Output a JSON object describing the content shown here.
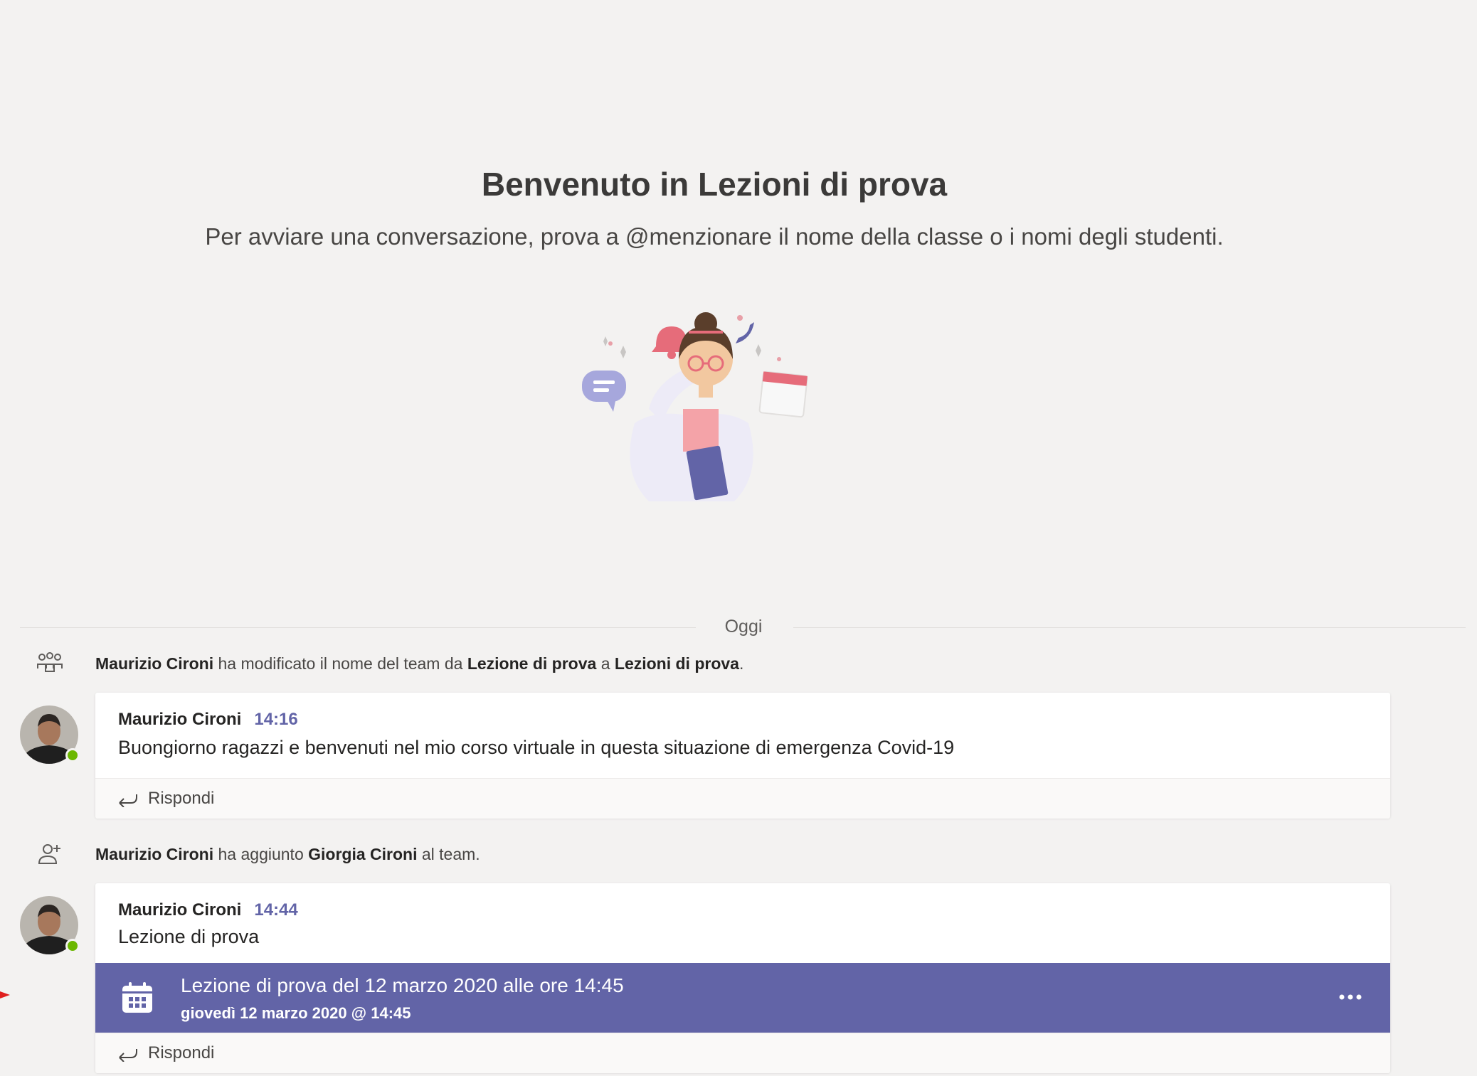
{
  "welcome": {
    "title": "Benvenuto in Lezioni di prova",
    "subtitle": "Per avviare una conversazione, prova a @menzionare il nome della classe o i nomi degli studenti."
  },
  "divider": {
    "label": "Oggi"
  },
  "events": [
    {
      "icon": "team-icon",
      "actor": "Maurizio Cironi",
      "text1": " ha modificato il nome del team da ",
      "old_name": "Lezione di prova",
      "text2": " a ",
      "new_name": "Lezioni di prova",
      "text3": "."
    },
    {
      "icon": "add-member-icon",
      "actor": "Maurizio Cironi",
      "text1": " ha aggiunto ",
      "member": "Giorgia Cironi",
      "text2": " al team."
    }
  ],
  "messages": [
    {
      "author": "Maurizio Cironi",
      "time": "14:16",
      "body": "Buongiorno ragazzi e benvenuti nel mio corso virtuale in questa situazione di emergenza Covid-19",
      "reply_label": "Rispondi"
    },
    {
      "author": "Maurizio Cironi",
      "time": "14:44",
      "body": "Lezione di prova",
      "meeting": {
        "title": "Lezione di prova del 12 marzo 2020 alle ore 14:45",
        "date": "giovedì 12 marzo 2020 @ 14:45",
        "icon": "calendar-icon"
      },
      "reply_label": "Rispondi"
    }
  ],
  "colors": {
    "accent": "#6264a7",
    "background": "#f3f2f1",
    "presence_available": "#6bb700"
  }
}
